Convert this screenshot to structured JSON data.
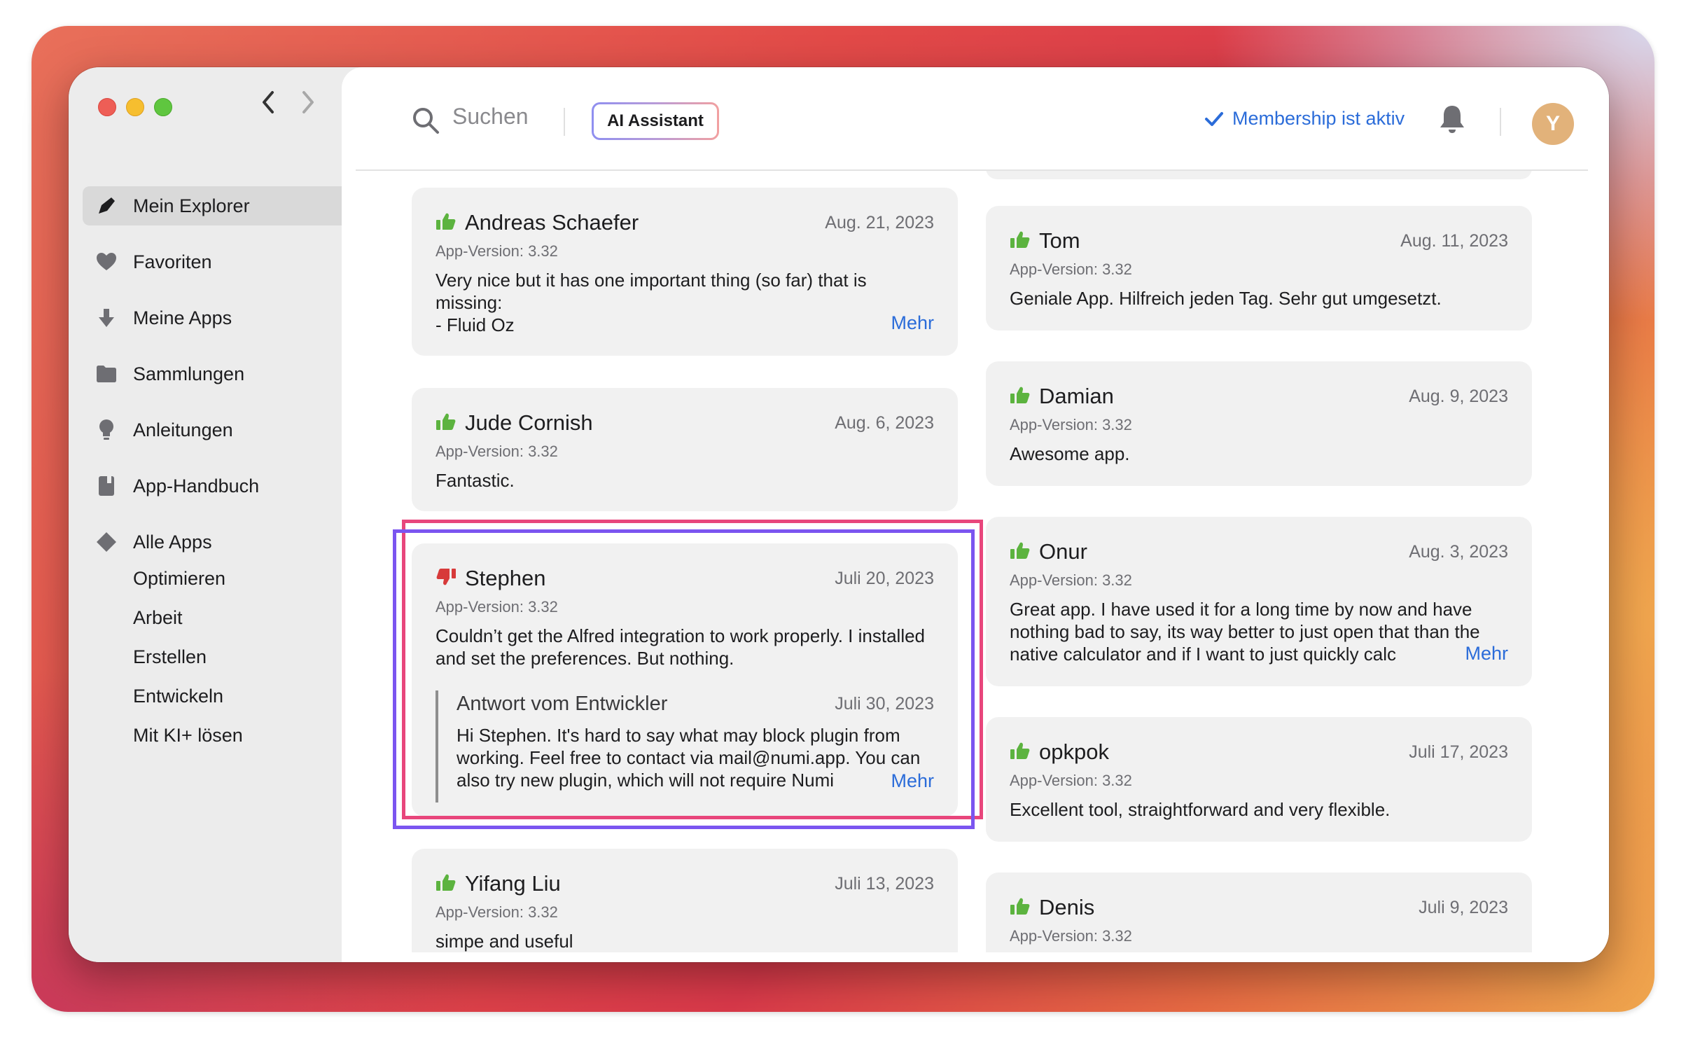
{
  "sidebar": {
    "nav_back": "‹",
    "nav_forward": "›",
    "items": [
      {
        "label": "Mein Explorer",
        "icon": "pen-icon"
      },
      {
        "label": "Favoriten",
        "icon": "heart-icon"
      },
      {
        "label": "Meine Apps",
        "icon": "download-arrow-icon"
      },
      {
        "label": "Sammlungen",
        "icon": "folder-icon"
      },
      {
        "label": "Anleitungen",
        "icon": "lightbulb-icon"
      },
      {
        "label": "App-Handbuch",
        "icon": "book-icon"
      },
      {
        "label": "Alle Apps",
        "icon": "diamond-icon"
      }
    ],
    "sub_items": [
      "Optimieren",
      "Arbeit",
      "Erstellen",
      "Entwickeln",
      "Mit KI+ lösen"
    ]
  },
  "topbar": {
    "search_placeholder": "Suchen",
    "ai_button": "AI Assistant",
    "membership": "Membership ist aktiv",
    "avatar_initial": "Y"
  },
  "reviews": {
    "left": [
      {
        "name": "Andreas Schaefer",
        "date": "Aug. 21, 2023",
        "version": "App-Version: 3.32",
        "text": "Very nice but it has one important thing (so far) that is missing:\n- Fluid Oz",
        "more": "Mehr",
        "rating": "positive"
      },
      {
        "name": "Jude Cornish",
        "date": "Aug. 6, 2023",
        "version": "App-Version: 3.32",
        "text": "Fantastic.",
        "rating": "positive"
      },
      {
        "name": "Stephen",
        "date": "Juli 20, 2023",
        "version": "App-Version: 3.32",
        "text": "Couldn’t get the Alfred integration to work properly. I installed and set the preferences. But nothing.",
        "rating": "negative",
        "reply": {
          "title": "Antwort vom Entwickler",
          "date": "Juli 30, 2023",
          "text": "Hi Stephen. It's hard to say what may block plugin from working. Feel free to contact via mail@numi.app. You can also try new plugin, which will not require Numi",
          "more": "Mehr"
        }
      },
      {
        "name": "Yifang Liu",
        "date": "Juli 13, 2023",
        "version": "App-Version: 3.32",
        "text": "simpe and useful",
        "rating": "positive"
      }
    ],
    "right": [
      {
        "name": "Tom",
        "date": "Aug. 11, 2023",
        "version": "App-Version: 3.32",
        "text": "Geniale App. Hilfreich jeden Tag. Sehr gut umgesetzt.",
        "rating": "positive"
      },
      {
        "name": "Damian",
        "date": "Aug. 9, 2023",
        "version": "App-Version: 3.32",
        "text": "Awesome app.",
        "rating": "positive"
      },
      {
        "name": "Onur",
        "date": "Aug. 3, 2023",
        "version": "App-Version: 3.32",
        "text": "Great app. I have used it for a long time by now and have nothing bad to say, its way better to just open that than the native calculator and if I want to just quickly calc",
        "more": "Mehr",
        "rating": "positive"
      },
      {
        "name": "opkpok",
        "date": "Juli 17, 2023",
        "version": "App-Version: 3.32",
        "text": "Excellent tool, straightforward and very flexible.",
        "rating": "positive"
      },
      {
        "name": "Denis",
        "date": "Juli 9, 2023",
        "version": "App-Version: 3.32",
        "text": "",
        "rating": "positive"
      }
    ]
  },
  "colors": {
    "accent_blue": "#2b6cd9",
    "thumbs_up": "#5cb33f",
    "thumbs_down": "#d73a3a",
    "highlight_pink": "#e8467c",
    "highlight_purple": "#7b55f0"
  }
}
